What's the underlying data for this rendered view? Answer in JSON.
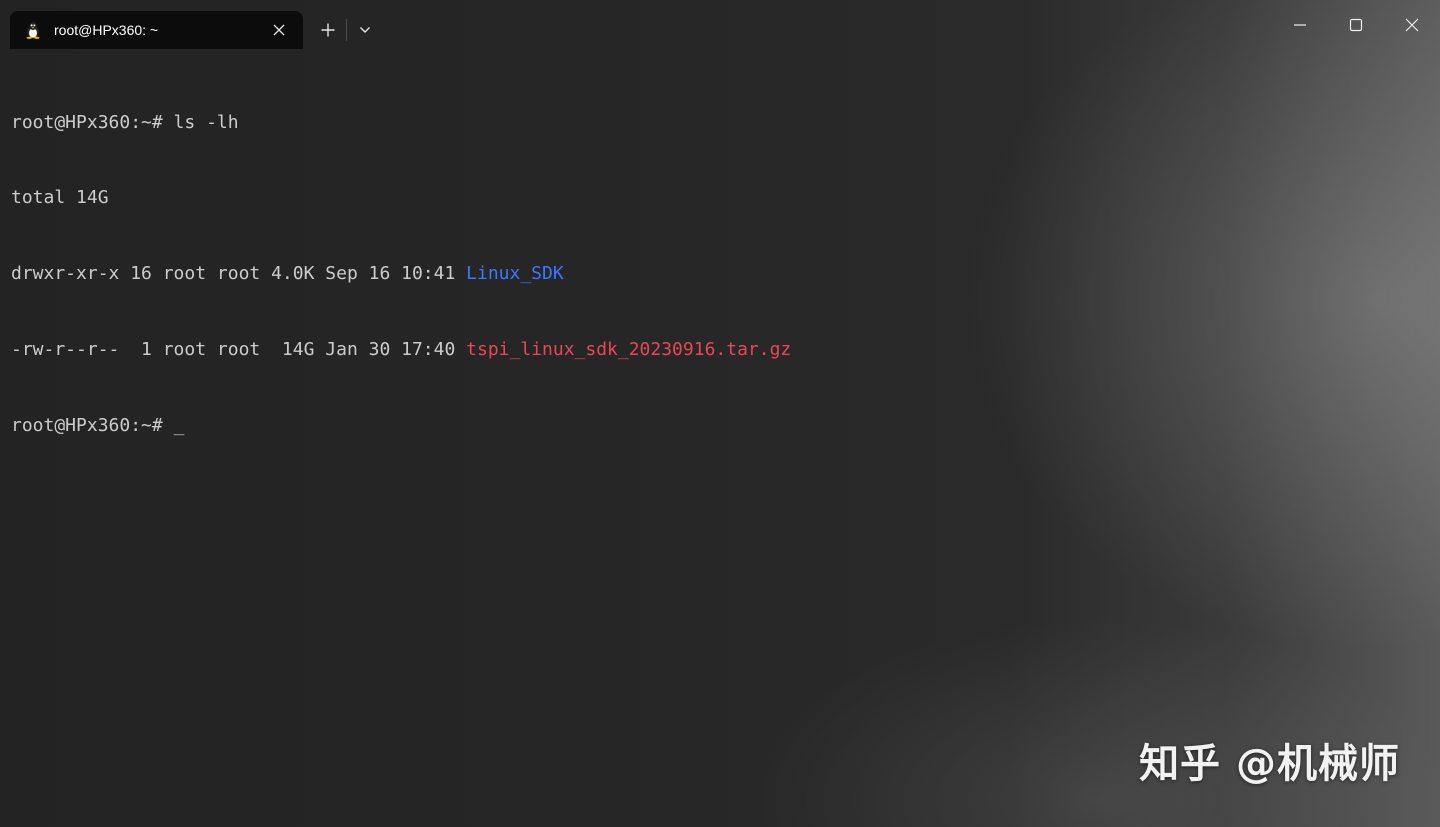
{
  "window": {
    "tab": {
      "title": "root@HPx360: ~",
      "icon": "linux-tux-icon"
    },
    "icons": {
      "close_tab": "close-icon",
      "new_tab": "plus-icon",
      "dropdown": "chevron-down-icon",
      "minimize": "minimize-icon",
      "maximize": "maximize-icon",
      "close_window": "close-icon"
    }
  },
  "terminal": {
    "lines": [
      {
        "text": "root@HPx360:~# ls -lh"
      },
      {
        "text": "total 14G"
      },
      {
        "prefix": "drwxr-xr-x 16 root root 4.0K Sep 16 10:41 ",
        "name": "Linux_SDK",
        "kind": "directory"
      },
      {
        "prefix": "-rw-r--r--  1 root root  14G Jan 30 17:40 ",
        "name": "tspi_linux_sdk_20230916.tar.gz",
        "kind": "archive"
      },
      {
        "prompt": "root@HPx360:~# ",
        "cursor": "_"
      }
    ]
  },
  "colors": {
    "foreground": "#cccccc",
    "directory": "#3b78ff",
    "archive": "#e74856",
    "tab_background": "#0c0c0c"
  },
  "watermark": {
    "text": "知乎 @机械师"
  }
}
